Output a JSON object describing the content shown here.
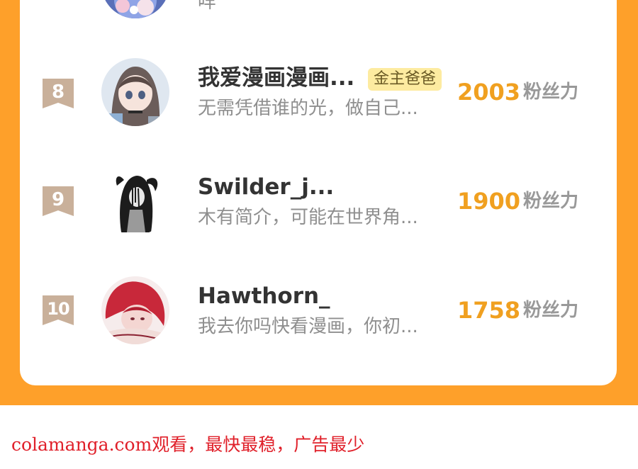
{
  "colors": {
    "frame": "#fea02a",
    "rank_badge": "#c9b09a",
    "score": "#f0a020",
    "badge_bg": "#fdeba0",
    "watermark": "#e0202a"
  },
  "top_partial": {
    "bio": "咩"
  },
  "rows": [
    {
      "rank": "8",
      "name": "我爱漫画漫画...",
      "badge": "金主爸爸",
      "bio": "无需凭借谁的光，做自己...",
      "score": "2003",
      "unit": "粉丝力"
    },
    {
      "rank": "9",
      "name": "Swilder_j...",
      "bio": "木有简介，可能在世界角...",
      "score": "1900",
      "unit": "粉丝力"
    },
    {
      "rank": "10",
      "name": "Hawthorn_",
      "bio": "我去你吗快看漫画，你初...",
      "score": "1758",
      "unit": "粉丝力"
    }
  ],
  "watermark": "colamanga.com观看，最快最稳，广告最少"
}
